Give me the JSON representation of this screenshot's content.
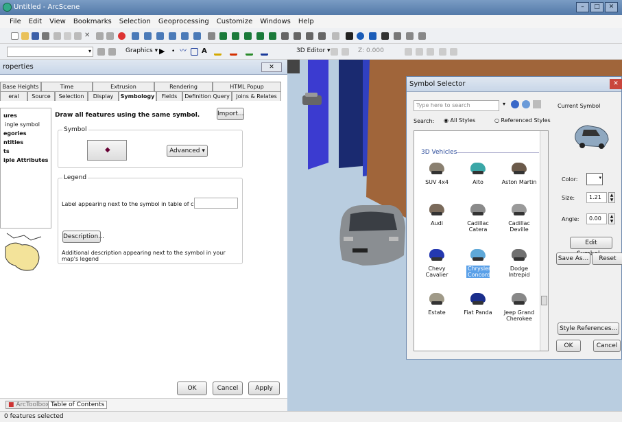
{
  "app": {
    "title": "Untitled - ArcScene",
    "status": "0 features selected"
  },
  "menu": [
    "File",
    "Edit",
    "View",
    "Bookmarks",
    "Selection",
    "Geoprocessing",
    "Customize",
    "Windows",
    "Help"
  ],
  "toolbar": {
    "graphics_label": "Graphics",
    "editor3d_label": "3D Editor",
    "z_value": "Z: 0.000"
  },
  "props": {
    "title": "roperties",
    "tabs_row1": [
      "Base Heights",
      "Time",
      "Extrusion",
      "Rendering",
      "HTML Popup"
    ],
    "tabs_row2": [
      "eral",
      "Source",
      "Selection",
      "Display",
      "Symbology",
      "Fields",
      "Definition Query",
      "Joins & Relates"
    ],
    "active_tab": "Symbology",
    "show_items": [
      "ures",
      "ingle symbol",
      "egories",
      "ntities",
      "ts",
      "iple Attributes"
    ],
    "heading": "Draw all features using the same symbol.",
    "import_btn": "Import...",
    "symbol_group": "Symbol",
    "advanced_btn": "Advanced",
    "legend_group": "Legend",
    "legend_label": "Label appearing next to the symbol in table of contents:",
    "description_btn": "Description...",
    "description_text": "Additional description appearing next to the symbol in your map's legend",
    "ok": "OK",
    "cancel": "Cancel",
    "apply": "Apply"
  },
  "bottom_tabs": [
    "ArcToolbox",
    "Table of Contents"
  ],
  "symsel": {
    "title": "Symbol Selector",
    "search_placeholder": "Type here to search",
    "search_label": "Search:",
    "all_styles": "All Styles",
    "ref_styles": "Referenced Styles",
    "category": "3D Vehicles",
    "items": [
      {
        "name": "SUV 4x4",
        "color": "#8a8070"
      },
      {
        "name": "Alto",
        "color": "#3aa7a7"
      },
      {
        "name": "Aston Martin",
        "color": "#6b5a4a"
      },
      {
        "name": "Audi",
        "color": "#7a6a5a"
      },
      {
        "name": "Cadillac Catera",
        "color": "#8a8a8a"
      },
      {
        "name": "Cadillac Deville",
        "color": "#9a9a9a"
      },
      {
        "name": "Chevy Cavalier",
        "color": "#2438b0"
      },
      {
        "name": "Chrysler Concorde",
        "color": "#5fa8d8"
      },
      {
        "name": "Dodge Intrepid",
        "color": "#707070"
      },
      {
        "name": "Estate",
        "color": "#a09a88"
      },
      {
        "name": "Fiat Panda",
        "color": "#1a2e8c"
      },
      {
        "name": "Jeep Grand Cherokee",
        "color": "#888888"
      }
    ],
    "selected": "Chrysler Concorde",
    "current_symbol_label": "Current Symbol",
    "color_label": "Color:",
    "size_label": "Size:",
    "size_value": "1.21",
    "angle_label": "Angle:",
    "angle_value": "0.00",
    "edit_symbol": "Edit Symbol...",
    "save_as": "Save As...",
    "reset": "Reset",
    "style_refs": "Style References...",
    "ok": "OK",
    "cancel": "Cancel"
  }
}
